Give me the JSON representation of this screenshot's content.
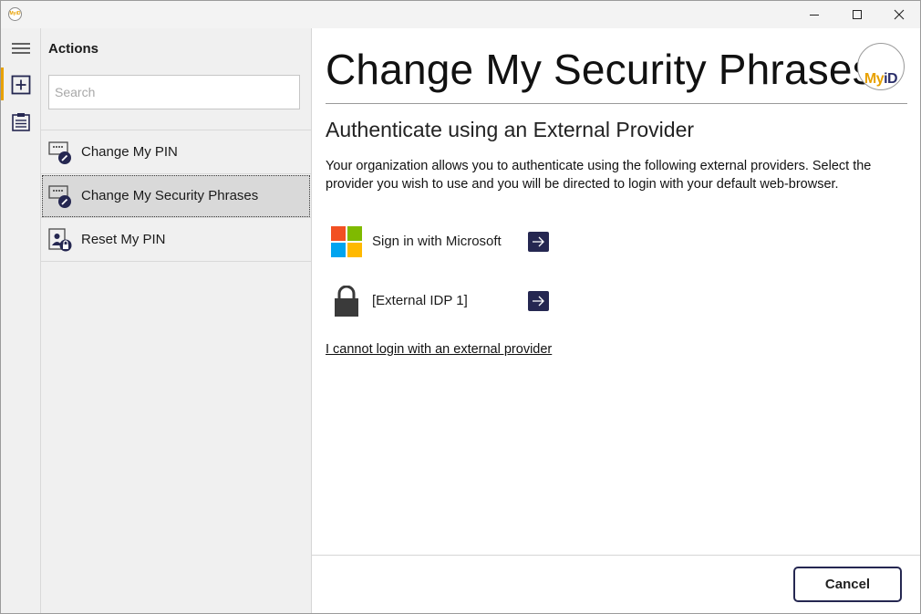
{
  "window": {
    "app_logo_text": "MyiD",
    "icons": {
      "minimize": "minimize-icon",
      "maximize": "maximize-icon",
      "close": "close-icon"
    }
  },
  "rail": {
    "items": [
      {
        "icon": "hamburger-menu-icon"
      },
      {
        "icon": "add-square-icon",
        "active": true
      },
      {
        "icon": "clipboard-list-icon"
      }
    ]
  },
  "actions_panel": {
    "title": "Actions",
    "search_placeholder": "Search",
    "items": [
      {
        "label": "Change My PIN",
        "icon": "change-pin-icon"
      },
      {
        "label": "Change My Security Phrases",
        "icon": "change-security-phrases-icon",
        "selected": true
      },
      {
        "label": "Reset My PIN",
        "icon": "reset-pin-icon"
      }
    ]
  },
  "main": {
    "title": "Change My Security Phrases",
    "brand": {
      "my": "My",
      "id": "iD"
    },
    "subtitle": "Authenticate using an External Provider",
    "description": "Your organization allows you to authenticate using the following external providers. Select the provider you wish to use and you will be directed to login with your default web-browser.",
    "providers": [
      {
        "label": "Sign in with Microsoft",
        "icon": "microsoft-logo-icon"
      },
      {
        "label": "[External IDP 1]",
        "icon": "lock-icon"
      }
    ],
    "no_external_link": "I cannot login with an external provider"
  },
  "footer": {
    "cancel_label": "Cancel"
  },
  "colors": {
    "accent": "#e8a100",
    "navy": "#252751",
    "selected_bg": "#d9d9d9",
    "panel_bg": "#f0f0f0"
  }
}
